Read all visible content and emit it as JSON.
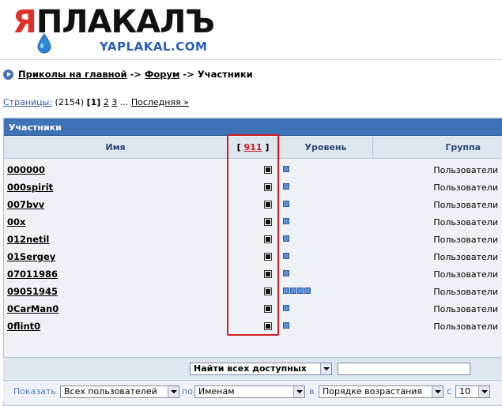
{
  "logo": {
    "text_red": "Я",
    "text_black": "ПЛАКАЛЪ",
    "url": "YAPLAKAL.COM"
  },
  "breadcrumb": {
    "home": "Приколы на главной",
    "sep1": "->",
    "forum": "Форум",
    "sep2": "->",
    "current": "Участники"
  },
  "pagination": {
    "label": "Страницы:",
    "total": "(2154)",
    "current": "[1]",
    "pages": [
      "2",
      "3"
    ],
    "ellipsis": "...",
    "last": "Последняя »"
  },
  "table": {
    "title": "Участники",
    "headers": {
      "name": "Имя",
      "count_open": "[",
      "count": "911",
      "count_close": "]",
      "level": "Уровень",
      "group": "Группа"
    },
    "rows": [
      {
        "name": "000000",
        "level": 1,
        "group": "Пользователи"
      },
      {
        "name": "000spirit",
        "level": 1,
        "group": "Пользователи"
      },
      {
        "name": "007bvv",
        "level": 1,
        "group": "Пользователи"
      },
      {
        "name": "00x",
        "level": 1,
        "group": "Пользователи"
      },
      {
        "name": "012netil",
        "level": 1,
        "group": "Пользователи"
      },
      {
        "name": "01Sergey",
        "level": 1,
        "group": "Пользователи"
      },
      {
        "name": "07011986",
        "level": 1,
        "group": "Пользователи"
      },
      {
        "name": "09051945",
        "level": 4,
        "group": "Пользователи"
      },
      {
        "name": "0CarMan0",
        "level": 1,
        "group": "Пользователи"
      },
      {
        "name": "0flint0",
        "level": 1,
        "group": "Пользователи"
      }
    ]
  },
  "search": {
    "scope": "Найти всех доступных",
    "query": ""
  },
  "filter": {
    "show_label": "Показать",
    "who": "Всех пользователей",
    "by_label": "по",
    "by": "Именам",
    "in_label": "в",
    "order": "Порядке возрастания",
    "count_label": "с",
    "count": "10"
  },
  "colors": {
    "header_bar": "#3d73b6",
    "highlight": "#d11f1f",
    "level_pip": "#5a8fd6"
  }
}
